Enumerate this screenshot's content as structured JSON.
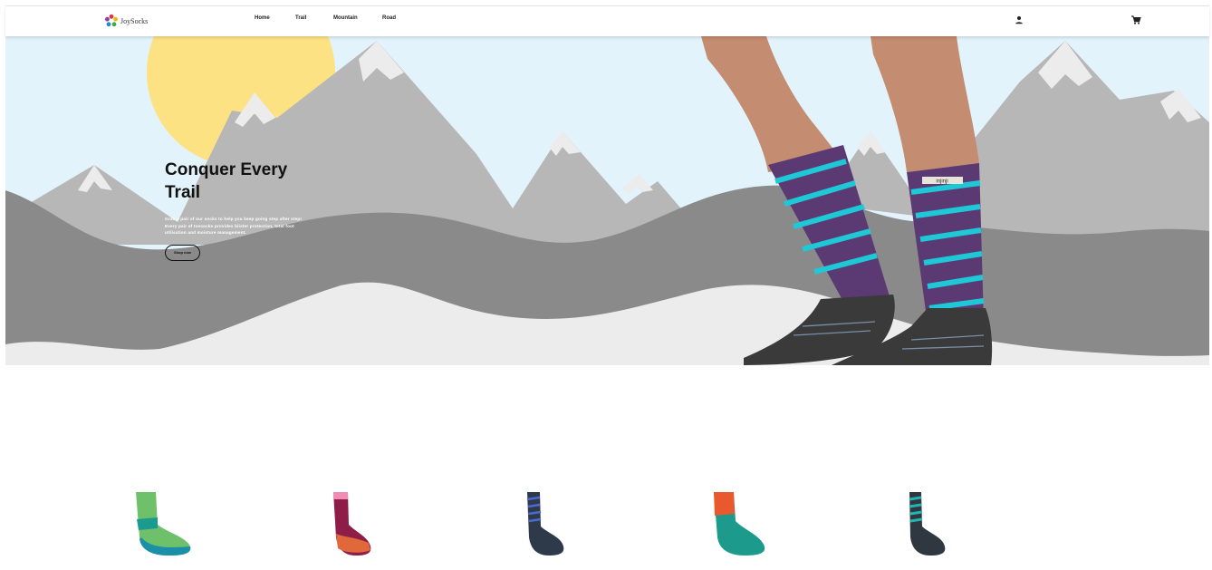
{
  "brand": {
    "name": "JoySocks"
  },
  "nav": {
    "links": [
      {
        "label": "Home"
      },
      {
        "label": "Trail"
      },
      {
        "label": "Mountain"
      },
      {
        "label": "Road"
      }
    ],
    "icons": [
      "account-icon",
      "cart-icon"
    ]
  },
  "hero": {
    "title": "Conquer Every Trail",
    "description": "Grab a pair of our socks to help you keep going step after step! Every pair of toesocks provides blister protection, total foot utilisation and moisture management.",
    "button_label": "Shop now",
    "sock_brand_tag": "injinji"
  },
  "colors": {
    "sky": "#e3f3fb",
    "sun": "#fde283",
    "mountain_light": "#b7b7b7",
    "mountain_dark": "#8a8a8a",
    "snow": "#ececec"
  },
  "products": [
    {
      "name": "green-teal-toe-sock"
    },
    {
      "name": "pink-maroon-toe-sock"
    },
    {
      "name": "purple-stripe-toe-sock"
    },
    {
      "name": "orange-teal-toe-sock"
    },
    {
      "name": "teal-stripe-toe-sock"
    }
  ]
}
